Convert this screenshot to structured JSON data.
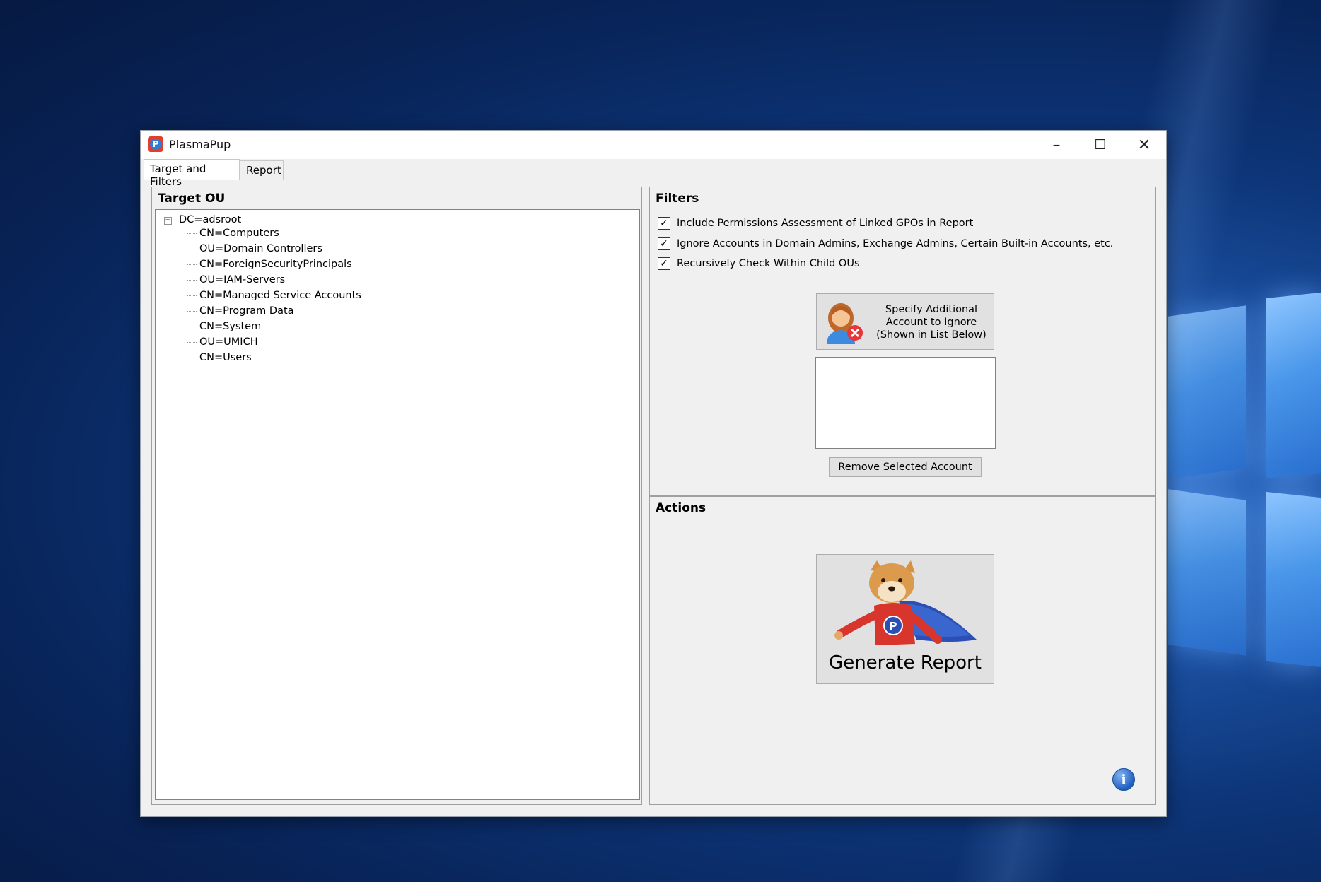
{
  "window": {
    "title": "PlasmaPup",
    "controls": {
      "minimize_icon": "–",
      "maximize_icon": "☐",
      "close_icon": "✕"
    }
  },
  "tabs": [
    {
      "label": "Target and Filters",
      "active": true
    },
    {
      "label": "Report",
      "active": false
    }
  ],
  "target_ou": {
    "heading": "Target OU",
    "root": {
      "label": "DC=adsroot",
      "expanded": true,
      "expander_glyph": "−"
    },
    "children": [
      "CN=Computers",
      "OU=Domain Controllers",
      "CN=ForeignSecurityPrincipals",
      "OU=IAM-Servers",
      "CN=Managed Service Accounts",
      "CN=Program Data",
      "CN=System",
      "OU=UMICH",
      "CN=Users"
    ]
  },
  "filters": {
    "heading": "Filters",
    "options": [
      {
        "label": "Include Permissions Assessment of Linked GPOs in Report",
        "checked": true
      },
      {
        "label": "Ignore Accounts in Domain Admins, Exchange Admins, Certain Built-in Accounts, etc.",
        "checked": true
      },
      {
        "label": "Recursively Check Within Child OUs",
        "checked": true
      }
    ],
    "check_glyph": "✓",
    "specify_button": {
      "line1": "Specify Additional",
      "line2": "Account to Ignore",
      "line3": "(Shown in List Below)",
      "icon": "user-remove-icon"
    },
    "ignored_accounts": [],
    "remove_button": "Remove Selected Account"
  },
  "actions": {
    "heading": "Actions",
    "generate_button": "Generate Report",
    "generate_icon": "doge-superhero-icon",
    "info_icon_glyph": "i"
  },
  "colors": {
    "accent_red": "#e23d2f",
    "accent_blue": "#2a7fd6",
    "window_bg": "#f0f0f0"
  }
}
